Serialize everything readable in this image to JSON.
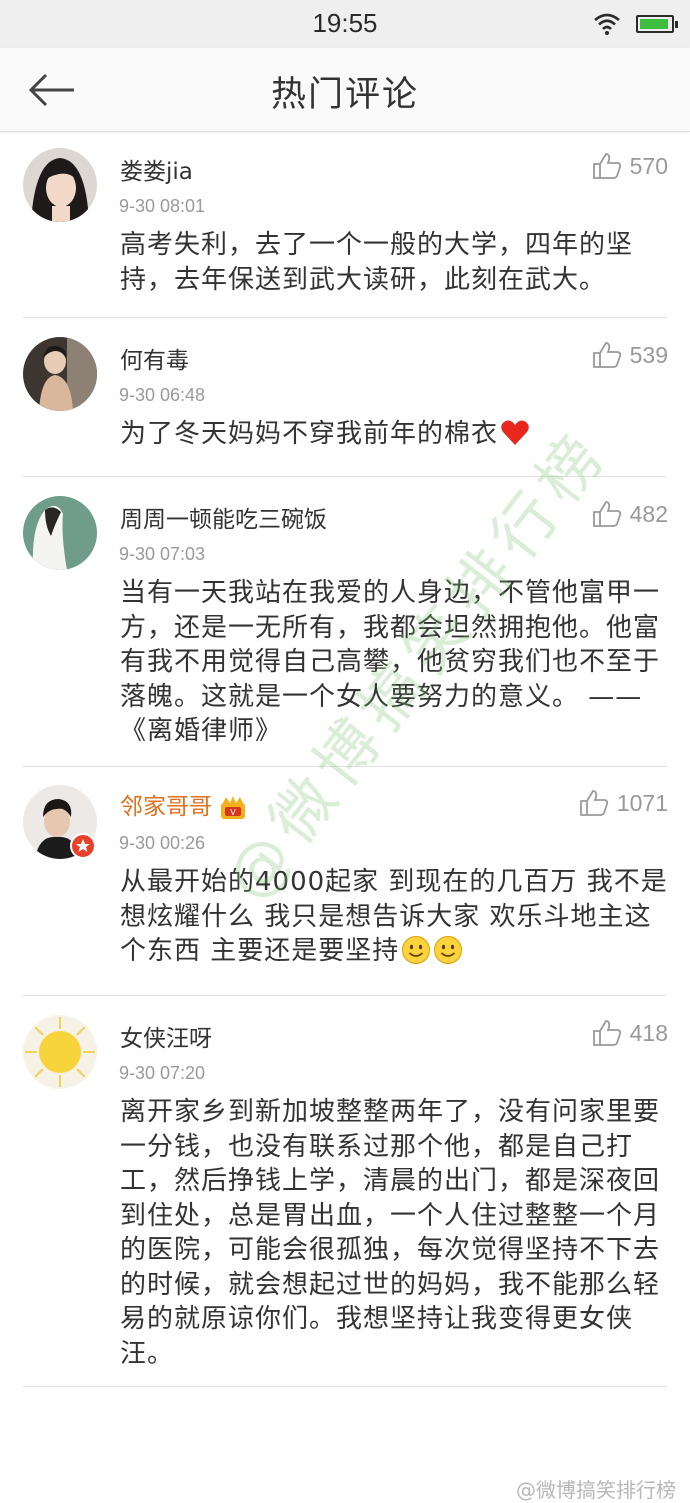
{
  "status": {
    "time": "19:55"
  },
  "nav": {
    "title": "热门评论"
  },
  "comments": [
    {
      "user": "娄娄jia",
      "time": "9-30 08:01",
      "likes": "570",
      "text": "高考失利，去了一个一般的大学，四年的坚持，去年保送到武大读研，此刻在武大。"
    },
    {
      "user": "何有毒",
      "time": "9-30 06:48",
      "likes": "539",
      "text": "为了冬天妈妈不穿我前年的棉衣"
    },
    {
      "user": "周周一顿能吃三碗饭",
      "time": "9-30 07:03",
      "likes": "482",
      "text": "当有一天我站在我爱的人身边，不管他富甲一方，还是一无所有，我都会坦然拥抱他。他富有我不用觉得自己高攀，他贫穷我们也不至于落魄。这就是一个女人要努力的意义。  ——《离婚律师》"
    },
    {
      "user": "邻家哥哥",
      "time": "9-30 00:26",
      "likes": "1071",
      "text": "从最开始的4000起家 到现在的几百万 我不是想炫耀什么 我只是想告诉大家 欢乐斗地主这个东西 主要还是要坚持"
    },
    {
      "user": "女侠汪呀",
      "time": "9-30 07:20",
      "likes": "418",
      "text": "离开家乡到新加坡整整两年了，没有问家里要一分钱，也没有联系过那个他，都是自己打工，然后挣钱上学，清晨的出门，都是深夜回到住处，总是胃出血，一个人住过整整一个月的医院，可能会很孤独，每次觉得坚持不下去的时候，就会想起过世的妈妈，我不能那么轻易的就原谅你们。我想坚持让我变得更女侠汪。"
    }
  ],
  "watermark": {
    "text": "@微博搞笑排行榜",
    "corner": "@微博搞笑排行榜"
  },
  "colors": {
    "vip_name": "#e0701c",
    "heart": "#e8271d",
    "watermark": "#7dbe6e"
  }
}
